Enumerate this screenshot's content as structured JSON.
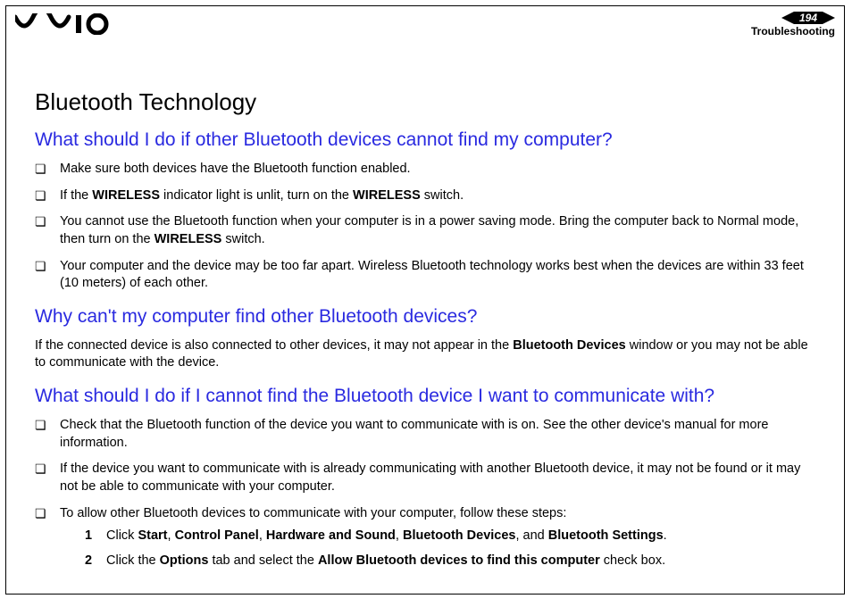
{
  "header": {
    "page_number": "194",
    "section": "Troubleshooting"
  },
  "title": "Bluetooth Technology",
  "q1": {
    "heading": "What should I do if other Bluetooth devices cannot find my computer?",
    "items": [
      {
        "pre": "Make sure both devices have the Bluetooth function enabled."
      },
      {
        "pre": "If the ",
        "b1": "WIRELESS",
        "mid": " indicator light is unlit, turn on the ",
        "b2": "WIRELESS",
        "post": " switch."
      },
      {
        "pre": "You cannot use the Bluetooth function when your computer is in a power saving mode. Bring the computer back to Normal mode, then turn on the ",
        "b1": "WIRELESS",
        "post": " switch."
      },
      {
        "pre": "Your computer and the device may be too far apart. Wireless Bluetooth technology works best when the devices are within 33 feet (10 meters) of each other."
      }
    ]
  },
  "q2": {
    "heading": "Why can't my computer find other Bluetooth devices?",
    "para_pre": "If the connected device is also connected to other devices, it may not appear in the ",
    "para_b": "Bluetooth Devices",
    "para_post": " window or you may not be able to communicate with the device."
  },
  "q3": {
    "heading": "What should I do if I cannot find the Bluetooth device I want to communicate with?",
    "items": [
      {
        "pre": "Check that the Bluetooth function of the device you want to communicate with is on. See the other device's manual for more information."
      },
      {
        "pre": "If the device you want to communicate with is already communicating with another Bluetooth device, it may not be found or it may not be able to communicate with your computer."
      },
      {
        "pre": "To allow other Bluetooth devices to communicate with your computer, follow these steps:"
      }
    ],
    "steps": [
      {
        "pre": "Click ",
        "b1": "Start",
        "s1": ", ",
        "b2": "Control Panel",
        "s2": ", ",
        "b3": "Hardware and Sound",
        "s3": ", ",
        "b4": "Bluetooth Devices",
        "s4": ", and ",
        "b5": "Bluetooth Settings",
        "post": "."
      },
      {
        "pre": "Click the ",
        "b1": "Options",
        "s1": " tab and select the ",
        "b2": "Allow Bluetooth devices to find this computer",
        "post": " check box."
      }
    ]
  }
}
